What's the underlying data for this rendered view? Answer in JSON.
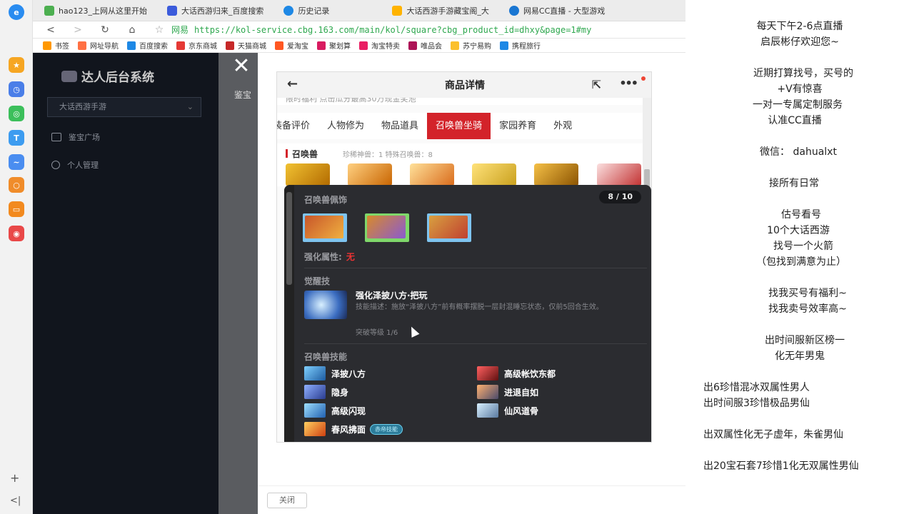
{
  "browser": {
    "tabs": [
      {
        "label": "hao123_上网从这里开始",
        "color": "#4caf50"
      },
      {
        "label": "大话西游归来_百度搜索",
        "color": "#3b5bdb"
      },
      {
        "label": "历史记录",
        "color": "#1e88e5"
      },
      {
        "label": "大话西游手游藏宝阁_大",
        "color": "#ffb300"
      },
      {
        "label": "网易CC直播 - 大型游戏",
        "color": "#1976d2"
      }
    ],
    "site_label": "网易",
    "url": "https://kol-service.cbg.163.com/main/kol/square?cbg_product_id=dhxy&page=1#my",
    "bookmarks": [
      {
        "label": "书签",
        "color": "#ff9800"
      },
      {
        "label": "网址导航",
        "color": "#ff7043"
      },
      {
        "label": "百度搜索",
        "color": "#1e88e5"
      },
      {
        "label": "京东商城",
        "color": "#e53935"
      },
      {
        "label": "天猫商城",
        "color": "#c62828"
      },
      {
        "label": "爱淘宝",
        "color": "#ff5722"
      },
      {
        "label": "聚划算",
        "color": "#d81b60"
      },
      {
        "label": "淘宝特卖",
        "color": "#e91e63"
      },
      {
        "label": "唯品会",
        "color": "#ad1457"
      },
      {
        "label": "苏宁易购",
        "color": "#fbc02d"
      },
      {
        "label": "携程旅行",
        "color": "#1e88e5"
      }
    ]
  },
  "admin": {
    "title": "达人后台系统",
    "game_select": "大话西游手游",
    "menu": [
      "鉴宝广场",
      "个人管理"
    ],
    "crumb": "鉴宝"
  },
  "modal": {
    "close_label": "关闭"
  },
  "phone": {
    "header_title": "商品详情",
    "promo_text": "限时福利 点击瓜分最高30万现金奖池",
    "tabs": [
      "装备评价",
      "人物修为",
      "物品道具",
      "召唤兽坐骑",
      "家园养育",
      "外观"
    ],
    "active_tab": "召唤兽坐骑",
    "pet_section": "召唤兽",
    "pet_stat": "珍稀神兽：1   特殊召唤兽：8"
  },
  "popup": {
    "ornament_title": "召唤兽佩饰",
    "counter": "8 / 10",
    "strength_label": "强化属性:",
    "strength_value": "无",
    "awaken_title": "觉醒技",
    "awaken_name": "强化泽披八方·把玩",
    "awaken_desc": "技能描述：施放“泽披八方”前有概率摆脱一层封混睡忘状态，仅前5回合生效。",
    "awaken_level": "突破等级 1/6",
    "skills_title": "召唤兽技能",
    "skills_left": [
      "泽披八方",
      "隐身",
      "高级闪现",
      "春风拂面"
    ],
    "skills_right": [
      "高级帐饮东都",
      "进退自如",
      "仙风道骨"
    ],
    "skill_badge": "赤帝技能"
  },
  "stream": {
    "lines": [
      "每天下午2-6点直播",
      "启辰彬仔欢迎您~",
      "近期打算找号，买号的",
      "+V有惊喜",
      "一对一专属定制服务",
      "认准CC直播",
      "微信：  dahualxt",
      "接所有日常",
      "估号看号",
      "10个大话西游",
      "找号一个火箭",
      "（包找到满意为止）",
      "找我买号有福利~",
      "找我卖号效率高~",
      "出时间服新区榜一",
      "化无年男鬼",
      "出6珍惜混冰双属性男人",
      "出时间服3珍惜极品男仙",
      "出双属性化无子虚年，朱雀男仙",
      "出20宝石套7珍惜1化无双属性男仙"
    ]
  }
}
